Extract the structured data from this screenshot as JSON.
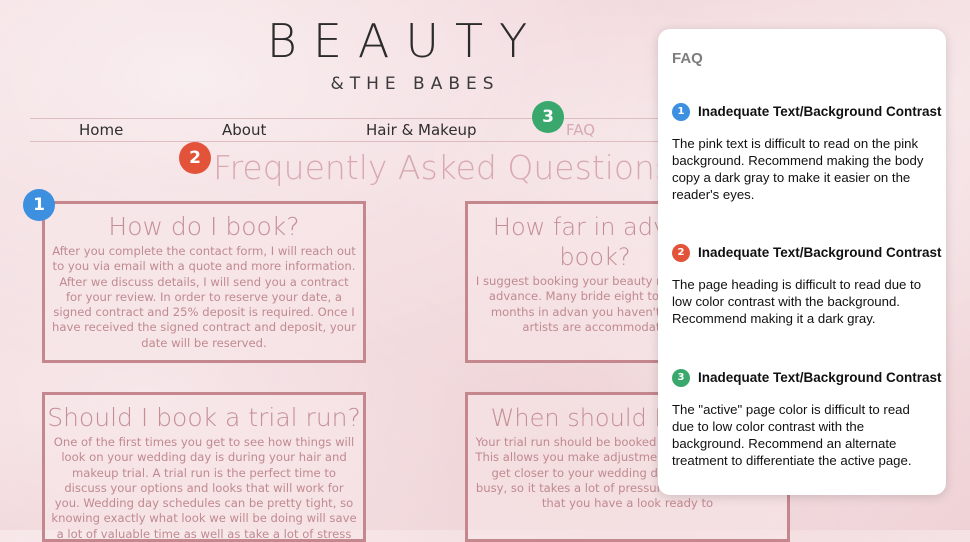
{
  "site": {
    "title": "BEAUTY",
    "subtitle": "&THE BABES"
  },
  "nav": {
    "items": [
      {
        "label": "Home"
      },
      {
        "label": "About"
      },
      {
        "label": "Hair & Makeup"
      },
      {
        "label": "FAQ",
        "active": true
      }
    ]
  },
  "page_heading": "Frequently Asked Questions",
  "markers": [
    "1",
    "2",
    "3"
  ],
  "cards": [
    {
      "question": "How do I book?",
      "answer": "After you complete the contact form, I will reach out to you via email with a quote and more information. After we discuss details, I will send you a contract for your review. In order to reserve your date, a signed contract and 25% deposit is required. Once I have received the signed contract and deposit, your date will be reserved."
    },
    {
      "question": "How far in advan book?",
      "answer": "I suggest booking your beauty months in advance. Many bride eight to twelve months in advan you haven't! If our artists are accommodate"
    },
    {
      "question": "Should I book a trial run?",
      "answer": "One of the first times you get to see how things will look on your wedding day is during your hair and makeup trial. A trial run is the perfect time to discuss your options and looks that will work for you. Wedding day schedules can be pretty tight, so knowing exactly what look we will be doing will save a lot of valuable time as well as take a lot of stress off of you on your big day."
    },
    {
      "question": "When should I trial run",
      "answer": "Your trial run should be booked th advance, at least. This allows you make adjustments if needed. As you get closer to your wedding day, it can get very busy, so it takes a lot of pressure off of you knowing that you have a look ready to"
    }
  ],
  "panel": {
    "title": "FAQ",
    "issues": [
      {
        "number": "1",
        "title": "Inadequate Text/Background Contrast",
        "body": "The pink text is difficult to read on the pink background. Recommend making the body copy a dark gray to make it easier on the reader's eyes.",
        "color": "#3d8fe0"
      },
      {
        "number": "2",
        "title": "Inadequate Text/Background Contrast",
        "body": "The page heading is difficult to read due to low color contrast with the background. Recommend making it a dark gray.",
        "color": "#e2533a"
      },
      {
        "number": "3",
        "title": "Inadequate Text/Background Contrast",
        "body": "The \"active\" page color is difficult to read due to low color contrast with the background. Recommend an alternate treatment to differentiate the active page.",
        "color": "#3aa86c"
      }
    ]
  },
  "colors": {
    "card_border": "#c4878d",
    "card_text": "#c08a90",
    "heading_pink": "#d9a9b0",
    "active_nav": "#d6aab0"
  }
}
